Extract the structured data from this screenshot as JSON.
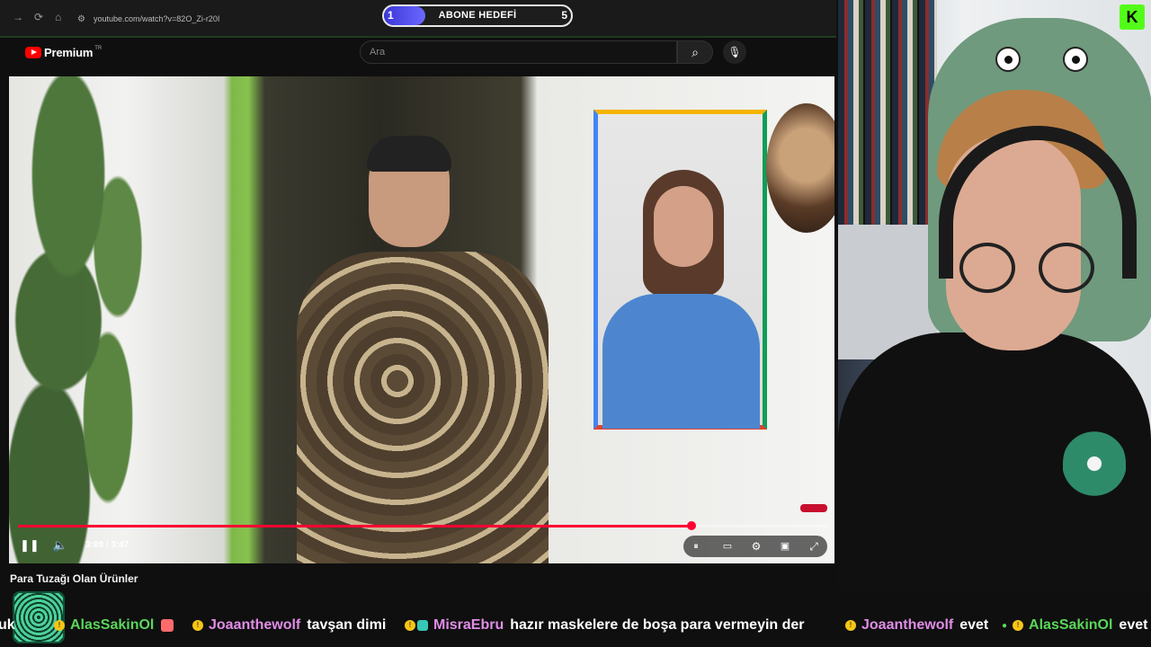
{
  "browser": {
    "back_icon": "→",
    "reload_icon": "⟳",
    "home_icon": "⌂",
    "url": "youtube.com/watch?v=82O_Zi-r20I"
  },
  "goal_overlay": {
    "current": "1",
    "label": "ABONE HEDEFİ",
    "target": "5",
    "progress_fraction": 0.2,
    "fill_color": "#4a46f0"
  },
  "youtube": {
    "brand": "Premium",
    "brand_sup": "TR",
    "search_placeholder": "Ara",
    "accent": "#ff0000"
  },
  "player": {
    "time": "3:09 / 3:47",
    "progress_fraction": 0.8326,
    "progress_color": "#ff0033",
    "title": "Para Tuzağı Olan Ürünler"
  },
  "webcam": {
    "platform_logo_letter": "K",
    "platform_color": "#53fc18"
  },
  "chat_ticker": [
    {
      "user_fragment": "uk"
    },
    {
      "user": "AlasSakinOl",
      "message": "",
      "color": "green"
    },
    {
      "user": "Joaanthewolf",
      "message": "tavşan dimi",
      "color": "pink"
    },
    {
      "user": "MisraEbru",
      "message": "hazır maskelere de boşa para vermeyin der",
      "color": "pink"
    },
    {
      "user": "Joaanthewolf",
      "message": "evet",
      "color": "pink"
    },
    {
      "user": "AlasSakinOl",
      "message": "evet",
      "color": "green"
    }
  ]
}
